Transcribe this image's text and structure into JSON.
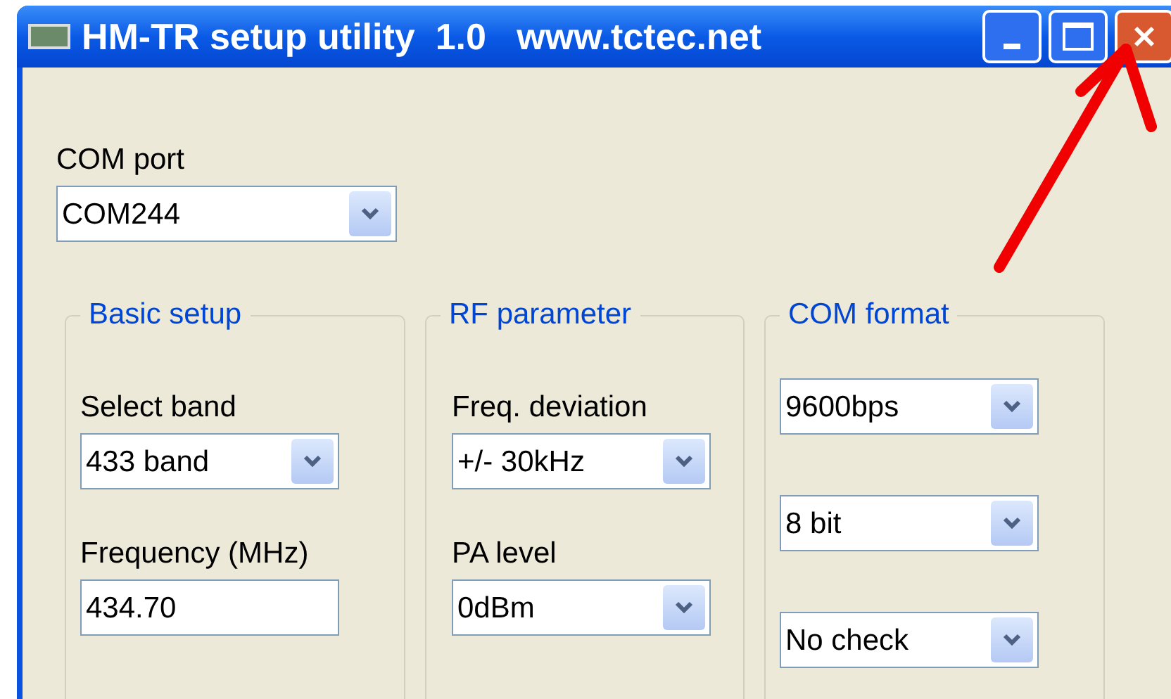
{
  "window": {
    "title": "HM-TR setup utility  1.0   www.tctec.net"
  },
  "com_port": {
    "label": "COM port",
    "value": "COM244"
  },
  "groups": [
    {
      "legend": "Basic setup",
      "fields": [
        {
          "kind": "dropdown",
          "label": "Select band",
          "value": "433 band"
        },
        {
          "kind": "text",
          "label": "Frequency (MHz)",
          "value": "434.70"
        }
      ]
    },
    {
      "legend": "RF parameter",
      "fields": [
        {
          "kind": "dropdown",
          "label": "Freq. deviation",
          "value": "+/- 30kHz"
        },
        {
          "kind": "dropdown",
          "label": "PA level",
          "value": "0dBm"
        }
      ]
    },
    {
      "legend": "COM format",
      "fields": [
        {
          "kind": "dropdown",
          "value": "9600bps"
        },
        {
          "kind": "dropdown",
          "value": "8 bit"
        },
        {
          "kind": "dropdown",
          "value": "No check"
        }
      ]
    }
  ]
}
